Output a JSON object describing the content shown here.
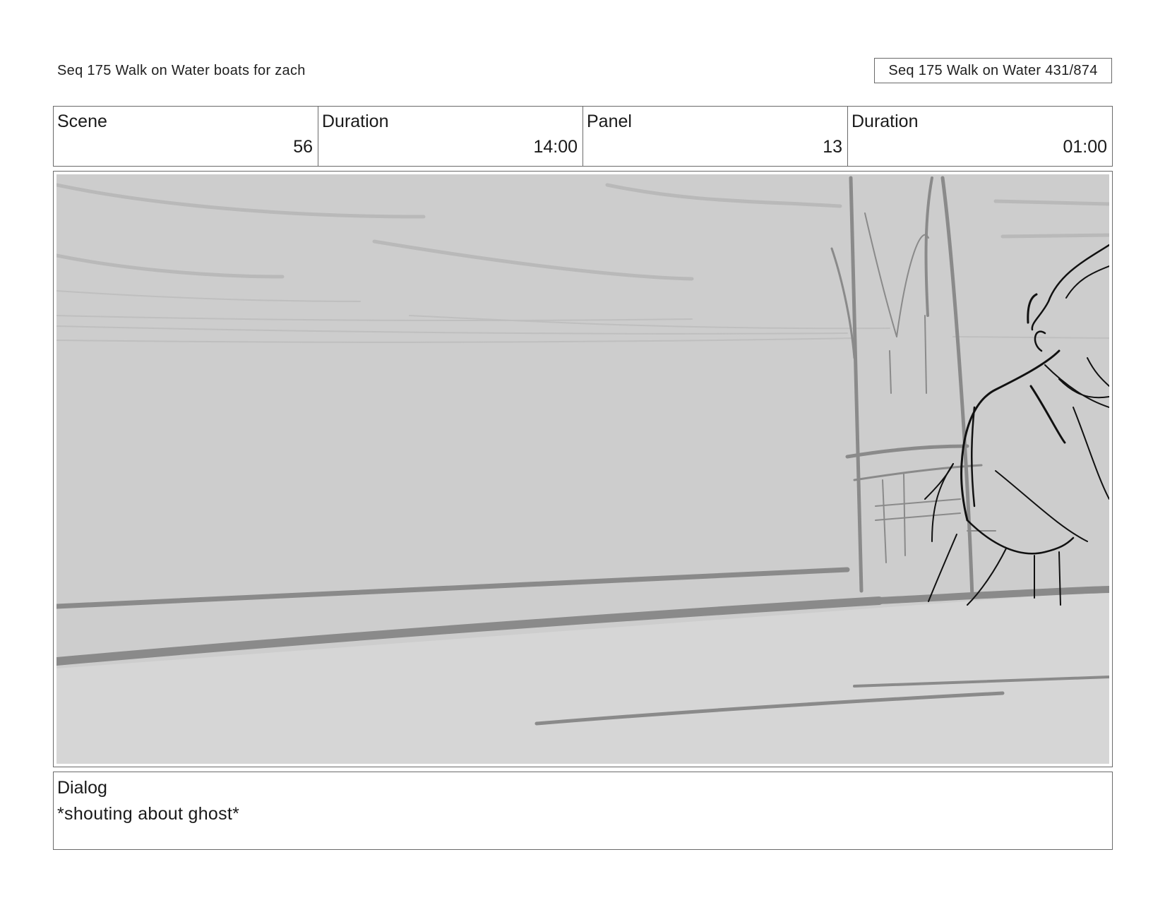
{
  "header": {
    "title": "Seq 175 Walk on Water  boats for zach",
    "page_counter": "Seq 175 Walk on Water 431/874"
  },
  "info": {
    "scene_label": "Scene",
    "scene_value": "56",
    "scene_duration_label": "Duration",
    "scene_duration_value": "14:00",
    "panel_label": "Panel",
    "panel_value": "13",
    "panel_duration_label": "Duration",
    "panel_duration_value": "01:00"
  },
  "dialog": {
    "label": "Dialog",
    "text": "*shouting about ghost*"
  },
  "colors": {
    "sky": "#cdcdcd",
    "deck": "#d6d6d6",
    "rail": "#8a8a8a",
    "ink": "#111111"
  }
}
